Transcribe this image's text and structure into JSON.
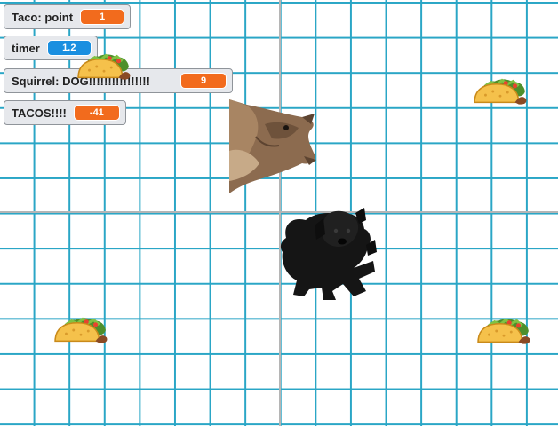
{
  "monitors": {
    "taco_point": {
      "label": "Taco: point",
      "value": "1"
    },
    "timer": {
      "label": "timer",
      "value": "1.2"
    },
    "squirrel": {
      "label": "Squirrel: DOG!!!!!!!!!!!!!!!!",
      "value": "9"
    },
    "tacos": {
      "label": "TACOS!!!!",
      "value": "-41"
    }
  },
  "colors": {
    "grid_line": "#2aa6c6",
    "axis_line": "#b5b5b5",
    "monitor_value_orange": "#f26b1d",
    "monitor_value_blue": "#1a8fe0"
  },
  "sprites": [
    "taco-sprite",
    "squirrel-sprite",
    "dog-sprite"
  ]
}
